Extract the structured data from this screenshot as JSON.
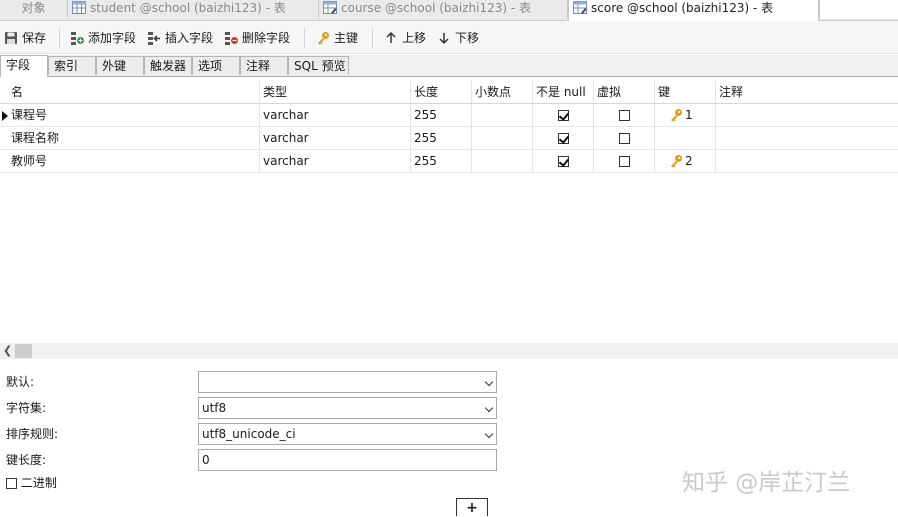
{
  "tabs": [
    {
      "label": "对象",
      "icon": "none",
      "active": false
    },
    {
      "label": "student @school (baizhi123) - 表",
      "icon": "table-icon",
      "active": false
    },
    {
      "label": "course @school (baizhi123) - 表",
      "icon": "table-edit-icon",
      "active": false
    },
    {
      "label": "score @school (baizhi123) - 表",
      "icon": "table-edit-icon",
      "active": true
    }
  ],
  "toolbar": {
    "save": "保存",
    "add_field": "添加字段",
    "insert_field": "插入字段",
    "delete_field": "删除字段",
    "primary_key": "主键",
    "move_up": "上移",
    "move_down": "下移"
  },
  "subtabs": [
    "字段",
    "索引",
    "外键",
    "触发器",
    "选项",
    "注释",
    "SQL 预览"
  ],
  "grid": {
    "headers": [
      "名",
      "类型",
      "长度",
      "小数点",
      "不是 null",
      "虚拟",
      "键",
      "注释"
    ],
    "rows": [
      {
        "name": "课程号",
        "type": "varchar",
        "length": "255",
        "decimal": "",
        "not_null": true,
        "virtual": false,
        "key": "1",
        "comment": "",
        "current": true
      },
      {
        "name": "课程名称",
        "type": "varchar",
        "length": "255",
        "decimal": "",
        "not_null": true,
        "virtual": false,
        "key": "",
        "comment": "",
        "current": false
      },
      {
        "name": "教师号",
        "type": "varchar",
        "length": "255",
        "decimal": "",
        "not_null": true,
        "virtual": false,
        "key": "2",
        "comment": "",
        "current": false
      }
    ]
  },
  "props": {
    "default_label": "默认:",
    "default_value": "",
    "charset_label": "字符集:",
    "charset_value": "utf8",
    "collation_label": "排序规则:",
    "collation_value": "utf8_unicode_ci",
    "keylen_label": "键长度:",
    "keylen_value": "0",
    "binary_label": "二进制",
    "binary_checked": false
  },
  "watermark": "知乎 @岸芷汀兰",
  "colors": {
    "key_gold": "#d9a21b",
    "accent_blue": "#3a6fb0",
    "delete_red": "#d23b2b",
    "add_green": "#2f9a3a"
  }
}
